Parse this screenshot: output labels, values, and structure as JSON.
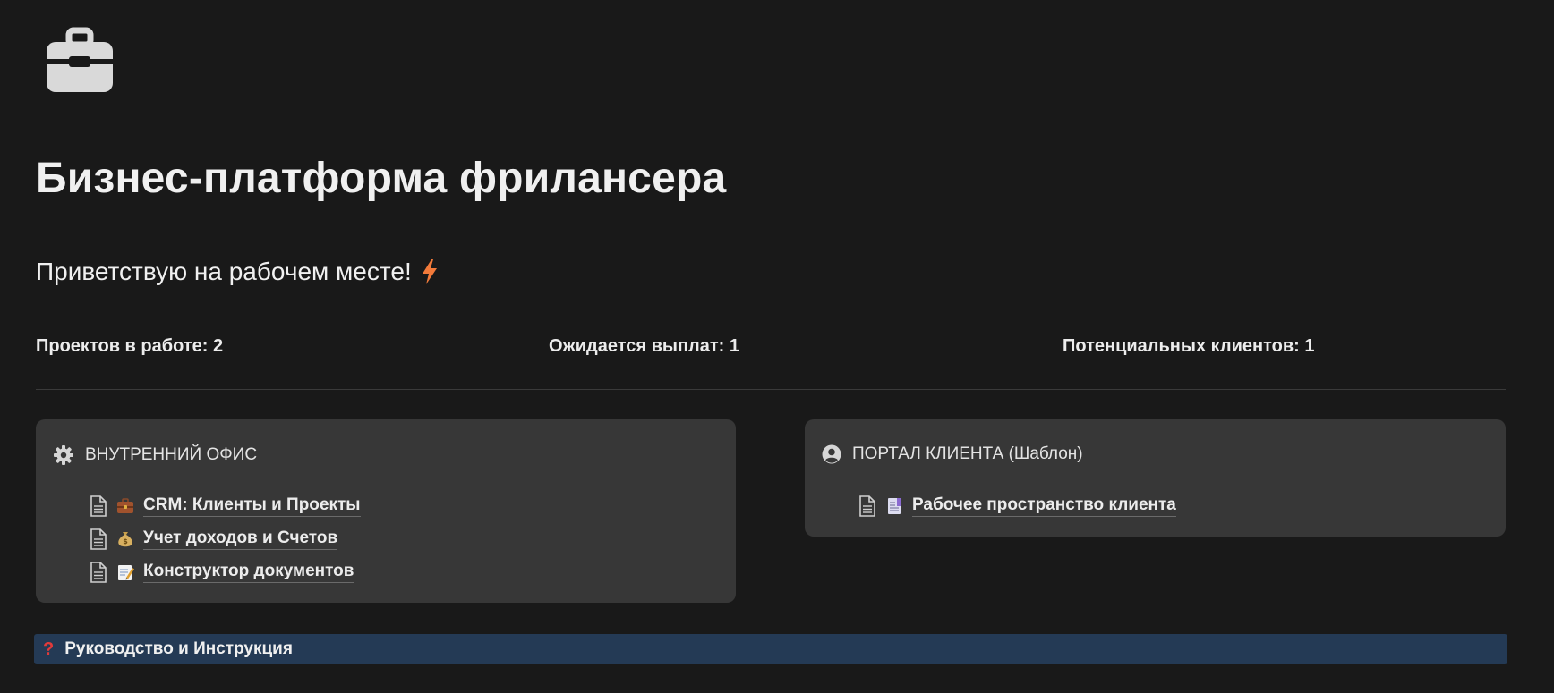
{
  "page": {
    "icon": "briefcase-icon",
    "title": "Бизнес-платформа фрилансера",
    "greeting": "Приветствую на рабочем месте!",
    "greeting_icon": "lightning-icon"
  },
  "stats": [
    {
      "label": "Проектов в работе: 2"
    },
    {
      "label": "Ожидается выплат: 1"
    },
    {
      "label": "Потенциальных клиентов: 1"
    }
  ],
  "cards": {
    "office": {
      "icon": "gear-icon",
      "title": "ВНУТРЕННИЙ ОФИС",
      "links": [
        {
          "emoji": "briefcase-icon",
          "label": "CRM: Клиенты и Проекты"
        },
        {
          "emoji": "money-bag-icon",
          "label": "Учет доходов и Счетов"
        },
        {
          "emoji": "memo-icon",
          "label": "Конструктор документов"
        }
      ]
    },
    "portal": {
      "icon": "user-circle-icon",
      "title": "ПОРТАЛ КЛИЕНТА (Шаблон)",
      "links": [
        {
          "emoji": "bookmark-tabs-icon",
          "label": "Рабочее пространство клиента"
        }
      ]
    }
  },
  "guide": {
    "icon": "question-mark-icon",
    "glyph": "?",
    "label": "Руководство и Инструкция"
  },
  "colors": {
    "background": "#191919",
    "card": "#373737",
    "guide_bar": "#243a55",
    "text": "#ececec",
    "accent_red": "#e23a3a"
  }
}
